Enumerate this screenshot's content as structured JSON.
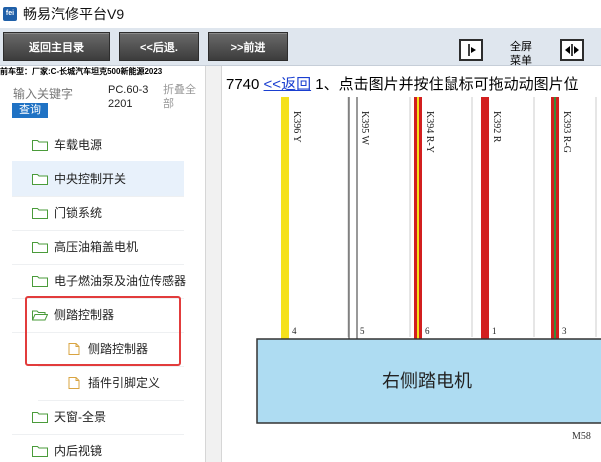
{
  "window": {
    "title": "畅易汽修平台V9",
    "icon_text": "fei"
  },
  "toolbar": {
    "home_label": "返回主目录",
    "back_label": "<<后退.",
    "forward_label": ">>前进",
    "fullscreen_label": "全屏\n菜单"
  },
  "vehicle": {
    "text": "前车型：厂家:C-长城汽车坦克500新能源2023"
  },
  "left": {
    "search_placeholder": "输入关键字",
    "query_label": "查询",
    "doc_code": "PC.60-32201",
    "collapse_all": "折叠全部",
    "tree": [
      {
        "label": "车载电源",
        "level": 0,
        "icon": "folder-icon"
      },
      {
        "label": "中央控制开关",
        "level": 0,
        "icon": "folder-icon",
        "selected": true
      },
      {
        "label": "门锁系统",
        "level": 0,
        "icon": "folder-icon"
      },
      {
        "label": "高压油箱盖电机",
        "level": 0,
        "icon": "folder-icon"
      },
      {
        "label": "电子燃油泵及油位传感器",
        "level": 0,
        "icon": "folder-icon"
      },
      {
        "label": "侧踏控制器",
        "level": 0,
        "icon": "folder-open-icon"
      },
      {
        "label": "侧踏控制器",
        "level": 1,
        "icon": "document-icon"
      },
      {
        "label": "插件引脚定义",
        "level": 1,
        "icon": "document-icon"
      },
      {
        "label": "天窗-全景",
        "level": 0,
        "icon": "folder-icon"
      },
      {
        "label": "内后视镜",
        "level": 0,
        "icon": "folder-icon"
      }
    ]
  },
  "content": {
    "hint_prefix": "7740",
    "back_link": "<<返回",
    "hint_text": "1、点击图片并按住鼠标可拖动动图片位",
    "wires": [
      {
        "label": "K396 Y",
        "pin": "4",
        "color": "#f5e11c",
        "stripe": ""
      },
      {
        "label": "K395 W",
        "pin": "5",
        "color": "#ffffff",
        "stripe": ""
      },
      {
        "label": "K394 R-Y",
        "pin": "6",
        "color": "#d21f1f",
        "stripe": "#f5e11c"
      },
      {
        "label": "K392 R",
        "pin": "1",
        "color": "#d21f1f",
        "stripe": ""
      },
      {
        "label": "K393 R-G",
        "pin": "3",
        "color": "#d21f1f",
        "stripe": "#3a8a3a"
      }
    ],
    "component_name": "右侧踏电机",
    "connector_code": "M58",
    "colors": {
      "component_fill": "#aedcf2",
      "accent": "#1f72c4",
      "highlight": "#e23c3c"
    }
  }
}
